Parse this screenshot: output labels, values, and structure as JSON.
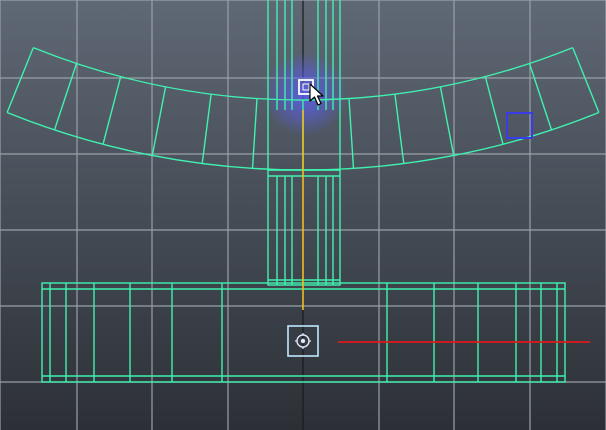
{
  "viewport": {
    "panel": "perspective-viewport",
    "background_top": "#5f6875",
    "background_bottom": "#2c3036",
    "grid_color": "#9aa0a8",
    "grid_axis_color": "#1a1a1a"
  },
  "colors": {
    "wireframe": "#3ff2b0",
    "selection_glow": "#5a5ff0",
    "selected_vertex": "#ffffff",
    "component_marker": "#3a3ce8",
    "y_axis": "#f0c020",
    "x_axis": "#e01818",
    "manipulator": "#bfe8ff"
  },
  "tools": {
    "cursor": "arrow-cursor-icon",
    "manipulator": "move-manipulator-icon"
  }
}
